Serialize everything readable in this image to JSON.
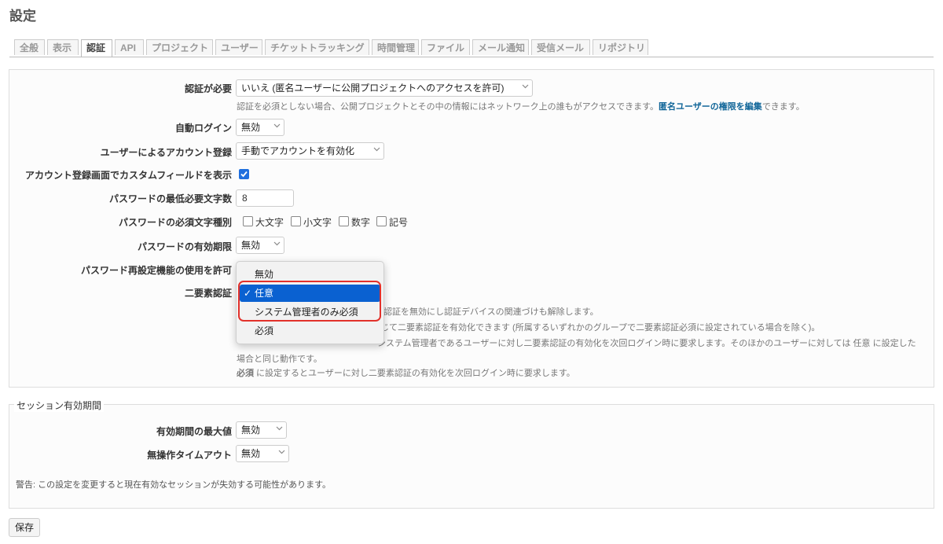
{
  "page": {
    "title": "設定"
  },
  "tabs": [
    "全般",
    "表示",
    "認証",
    "API",
    "プロジェクト",
    "ユーザー",
    "チケットトラッキング",
    "時間管理",
    "ファイル",
    "メール通知",
    "受信メール",
    "リポジトリ"
  ],
  "active_tab": "認証",
  "auth": {
    "login_required": {
      "label": "認証が必要",
      "value": "いいえ (匿名ユーザーに公開プロジェクトへのアクセスを許可)",
      "hint_before": "認証を必須としない場合、公開プロジェクトとその中の情報にはネットワーク上の誰もがアクセスできます。",
      "hint_link": "匿名ユーザーの権限を編集",
      "hint_after": "できます。"
    },
    "autologin": {
      "label": "自動ログイン",
      "value": "無効"
    },
    "self_registration": {
      "label": "ユーザーによるアカウント登録",
      "value": "手動でアカウントを有効化"
    },
    "custom_fields": {
      "label": "アカウント登録画面でカスタムフィールドを表示",
      "checked": true
    },
    "password_min_length": {
      "label": "パスワードの最低必要文字数",
      "value": "8"
    },
    "password_required_chars": {
      "label": "パスワードの必須文字種別",
      "options": [
        "大文字",
        "小文字",
        "数字",
        "記号"
      ]
    },
    "password_expiration": {
      "label": "パスワードの有効期限",
      "value": "無効"
    },
    "lost_password": {
      "label": "パスワード再設定機能の使用を許可"
    },
    "twofa": {
      "label": "二要素認証",
      "hint1": "認証を無効にし認証デバイスの関連づけも解除します。",
      "hint2": "じて二要素認証を有効化できます (所属するいずれかのグループで二要素認証必須に設定されている場合を除く)。",
      "hint3": "システム管理者であるユーザーに対し二要素認証の有効化を次回ログイン時に要求します。そのほかのユーザーに対しては 任意 に設定した",
      "hint4": "場合と同じ動作です。",
      "hint5_bold": "必須",
      "hint5": " に設定するとユーザーに対し二要素認証の有効化を次回ログイン時に要求します。"
    },
    "twofa_dropdown": {
      "options": [
        "無効",
        "任意",
        "システム管理者のみ必須",
        "必須"
      ],
      "selected": "任意",
      "checkmark": "✓"
    }
  },
  "session": {
    "legend": "セッション有効期間",
    "max_age": {
      "label": "有効期間の最大値",
      "value": "無効"
    },
    "timeout": {
      "label": "無操作タイムアウト",
      "value": "無効"
    },
    "warning": "警告: この設定を変更すると現在有効なセッションが失効する可能性があります。"
  },
  "buttons": {
    "save": "保存"
  },
  "colors": {
    "link": "#116699",
    "accent": "#0a61d1",
    "highlight": "#e2312b"
  }
}
